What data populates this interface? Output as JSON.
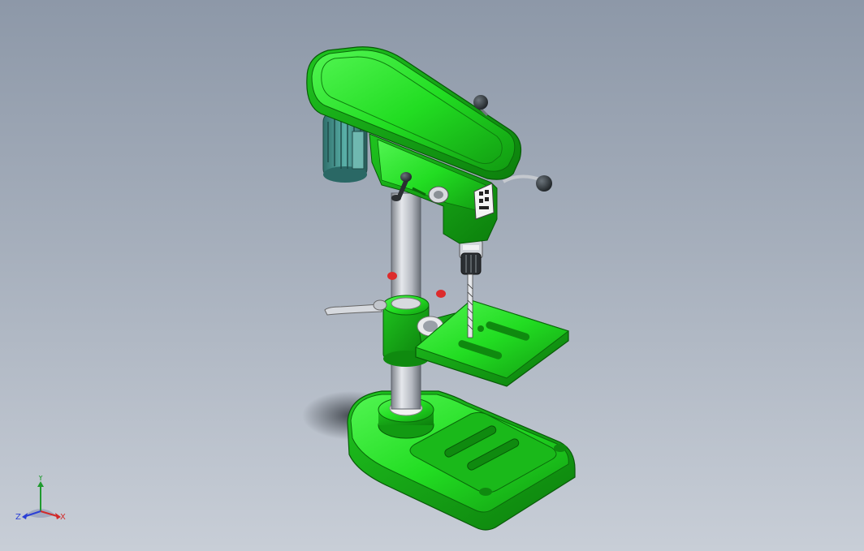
{
  "viewport": {
    "background_top": "#8d98a8",
    "background_bottom": "#c8ced7"
  },
  "model": {
    "body_color": "#22dd22",
    "column_color": "#b8bcc4",
    "motor_color": "#3c8a86",
    "knob_color": "#2a2f33",
    "switch_color": "#dd2b2b"
  },
  "triad": {
    "x_label": "X",
    "y_label": "Y",
    "z_label": "Z",
    "x_color": "#d22a2a",
    "y_color": "#1f9a2e",
    "z_color": "#2b3fd6"
  }
}
